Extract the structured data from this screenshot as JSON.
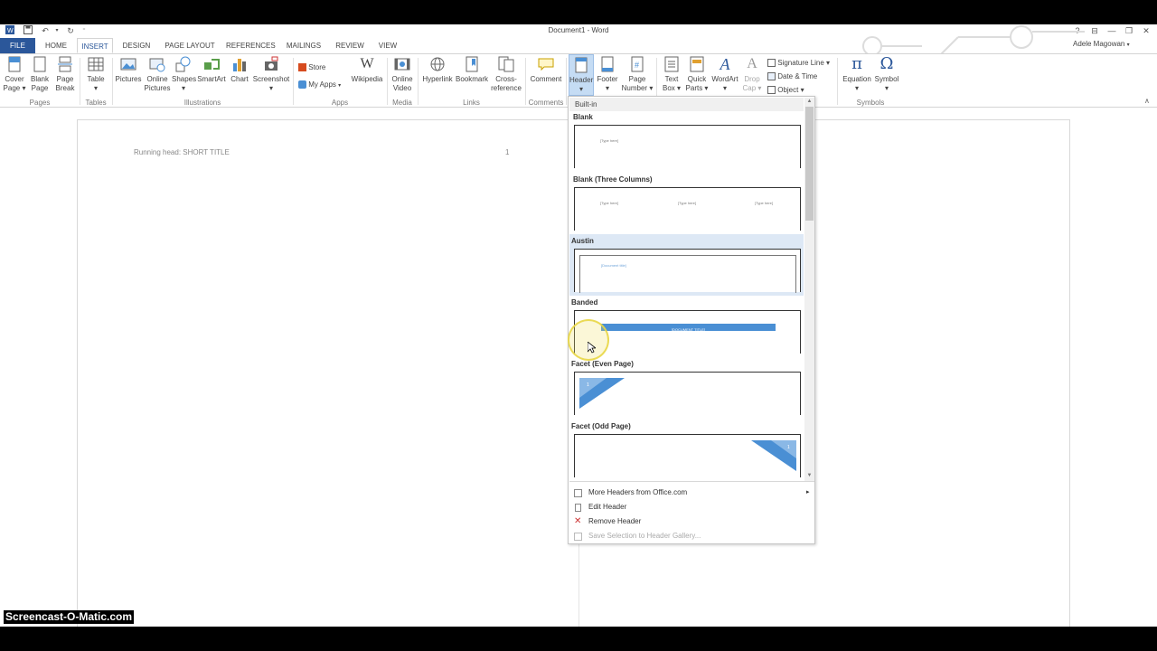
{
  "title": "Document1 - Word",
  "user": "Adele Magowan",
  "window_buttons": [
    "?",
    "⊟",
    "—",
    "❐",
    "✕"
  ],
  "tabs": [
    "FILE",
    "HOME",
    "INSERT",
    "DESIGN",
    "PAGE LAYOUT",
    "REFERENCES",
    "MAILINGS",
    "REVIEW",
    "VIEW"
  ],
  "active_tab": "INSERT",
  "ribbon": {
    "pages": {
      "label": "Pages",
      "cover_page": [
        "Cover",
        "Page ▾"
      ],
      "blank_page": [
        "Blank",
        "Page"
      ],
      "page_break": [
        "Page",
        "Break"
      ]
    },
    "tables": {
      "label": "Tables",
      "table": [
        "Table",
        "▾"
      ]
    },
    "illustrations": {
      "label": "Illustrations",
      "pictures": "Pictures",
      "online_pictures": [
        "Online",
        "Pictures"
      ],
      "shapes": [
        "Shapes",
        "▾"
      ],
      "smartart": "SmartArt",
      "chart": "Chart",
      "screenshot": [
        "Screenshot",
        "▾"
      ]
    },
    "apps": {
      "label": "Apps",
      "store": "Store",
      "my_apps": "My Apps",
      "wikipedia": "Wikipedia"
    },
    "media": {
      "label": "Media",
      "online_video": [
        "Online",
        "Video"
      ]
    },
    "links": {
      "label": "Links",
      "hyperlink": "Hyperlink",
      "bookmark": "Bookmark",
      "cross_reference": [
        "Cross-",
        "reference"
      ]
    },
    "comments": {
      "label": "Comments",
      "comment": "Comment"
    },
    "header_footer": {
      "header": [
        "Header",
        "▾"
      ],
      "footer": [
        "Footer",
        "▾"
      ],
      "page_number": [
        "Page",
        "Number ▾"
      ]
    },
    "text": {
      "text_box": [
        "Text",
        "Box ▾"
      ],
      "quick_parts": [
        "Quick",
        "Parts ▾"
      ],
      "wordart": [
        "WordArt",
        "▾"
      ],
      "drop_cap": [
        "Drop",
        "Cap ▾"
      ],
      "signature_line": "Signature Line ▾",
      "date_time": "Date & Time",
      "object": "Object ▾"
    },
    "symbols": {
      "label": "Symbols",
      "equation": [
        "Equation",
        "▾"
      ],
      "symbol": [
        "Symbol",
        "▾"
      ]
    }
  },
  "document": {
    "running_head": "Running head: SHORT TITLE",
    "page_number": "1"
  },
  "gallery": {
    "section": "Built-in",
    "items": [
      {
        "name": "Blank"
      },
      {
        "name": "Blank (Three Columns)"
      },
      {
        "name": "Austin"
      },
      {
        "name": "Banded"
      },
      {
        "name": "Facet (Even Page)"
      },
      {
        "name": "Facet (Odd Page)"
      }
    ],
    "placeholders": {
      "type_here": "[Type here]",
      "document_title_lower": "[Document title]",
      "document_title_upper": "[DOCUMENT TITLE]",
      "number": "1"
    },
    "menu": [
      {
        "label": "More Headers from Office.com",
        "enabled": true,
        "arrow": "▸"
      },
      {
        "label": "Edit Header",
        "enabled": true
      },
      {
        "label": "Remove Header",
        "enabled": true
      },
      {
        "label": "Save Selection to Header Gallery...",
        "enabled": false
      }
    ]
  },
  "watermark": "Screencast-O-Matic.com",
  "colors": {
    "file_tab": "#2b579a",
    "accent_blue": "#4a8fd4",
    "selection": "#dde8f5",
    "highlight_circle": "#f0e060"
  }
}
